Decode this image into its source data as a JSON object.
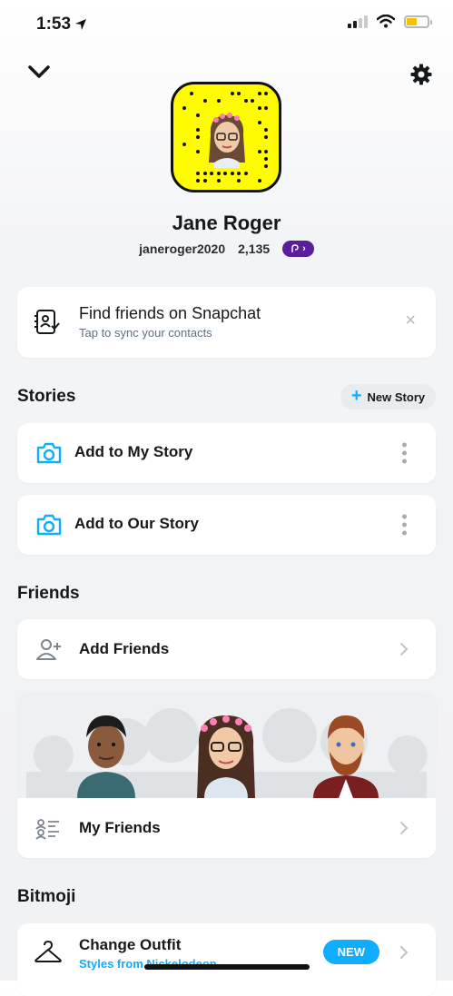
{
  "status_bar": {
    "time": "1:53",
    "signal_bars_on": 2,
    "battery_level": 0.45,
    "battery_color": "#f2c200"
  },
  "header": {
    "collapse_icon": "chevron-down-icon",
    "settings_icon": "gear-icon"
  },
  "profile": {
    "display_name": "Jane Roger",
    "username": "janeroger2020",
    "snap_score": "2,135",
    "score_arrow": "›",
    "accent": "#fffc00"
  },
  "find_friends": {
    "title": "Find friends on Snapchat",
    "subtitle": "Tap to sync your contacts",
    "dismiss": "×"
  },
  "stories": {
    "section_title": "Stories",
    "new_story_plus": "+",
    "new_story_label": "New Story",
    "items": [
      {
        "label": "Add to My Story"
      },
      {
        "label": "Add to Our Story"
      }
    ]
  },
  "friends": {
    "section_title": "Friends",
    "add_friends_label": "Add Friends",
    "my_friends_label": "My Friends"
  },
  "bitmoji": {
    "section_title": "Bitmoji",
    "change_outfit_title": "Change Outfit",
    "change_outfit_subtitle": "Styles from Nickelodeon",
    "badge": "NEW"
  },
  "colors": {
    "link_blue": "#0fadff",
    "score_purple": "#5a1e9c"
  }
}
